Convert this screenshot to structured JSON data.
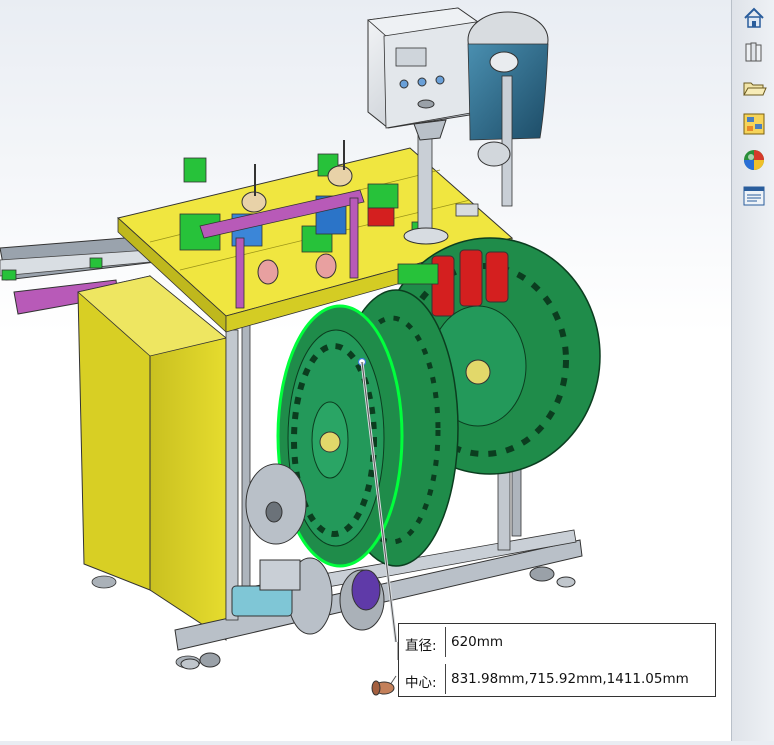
{
  "measure": {
    "diameter_label": "直径:",
    "diameter_value": "620mm",
    "center_label": "中心:",
    "center_value": "831.98mm,715.92mm,1411.05mm"
  },
  "taskpane": {
    "buttons": [
      "home-icon",
      "design-library-icon",
      "file-explorer-icon",
      "view-palette-icon",
      "appearances-icon",
      "custom-properties-icon"
    ]
  },
  "colors": {
    "selection": "#00ff3c",
    "cabinet": "#e2d826",
    "table_top": "#f0e640",
    "reel": "#1f8c4a",
    "frame": "#b9c0c8",
    "motor": "#7fc6d6",
    "accent_red": "#d41f1f"
  }
}
